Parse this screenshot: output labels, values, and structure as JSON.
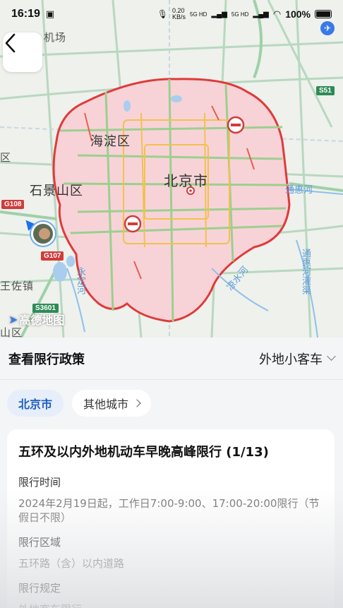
{
  "status_bar": {
    "time": "16:19",
    "net_speed_top": "0.20",
    "net_speed_unit": "KB/s",
    "net_type_1": "5G HD",
    "net_type_2": "5G HD",
    "battery": "100%"
  },
  "map": {
    "labels": {
      "airport": "机场",
      "haidian": "海淀区",
      "beijing": "北京市",
      "shijingshan": "石景山区",
      "wangzuo": "王佐镇",
      "shan": "山区",
      "left_edge": "区",
      "tonghui": "通惠河",
      "liangshui": "凉水河",
      "yongding": "永定河",
      "tonghui_guan": "通惠河灌渠"
    },
    "shields": {
      "g108": "G108",
      "g107": "G107",
      "s3601": "S3601",
      "s51": "S51"
    },
    "logo": "高德地图"
  },
  "panel": {
    "title": "查看限行政策",
    "vehicle_type": "外地小客车",
    "tabs": [
      {
        "label": "北京市"
      },
      {
        "label": "其他城市"
      }
    ],
    "policy": {
      "title": "五环及以内外地机动车早晚高峰限行 (1/13)",
      "fields": [
        {
          "label": "限行时间",
          "value": "2024年2月19日起，工作日7:00-9:00、17:00-20:00限行（节假日不限）"
        },
        {
          "label": "限行区域",
          "value": "五环路（含）以内道路"
        },
        {
          "label": "限行规定",
          "value": "外地客车限行"
        }
      ]
    }
  },
  "colors": {
    "restriction_outline": "#e03a3a",
    "restriction_fill": "#f7d3d8",
    "accent": "#1f5fbf"
  }
}
